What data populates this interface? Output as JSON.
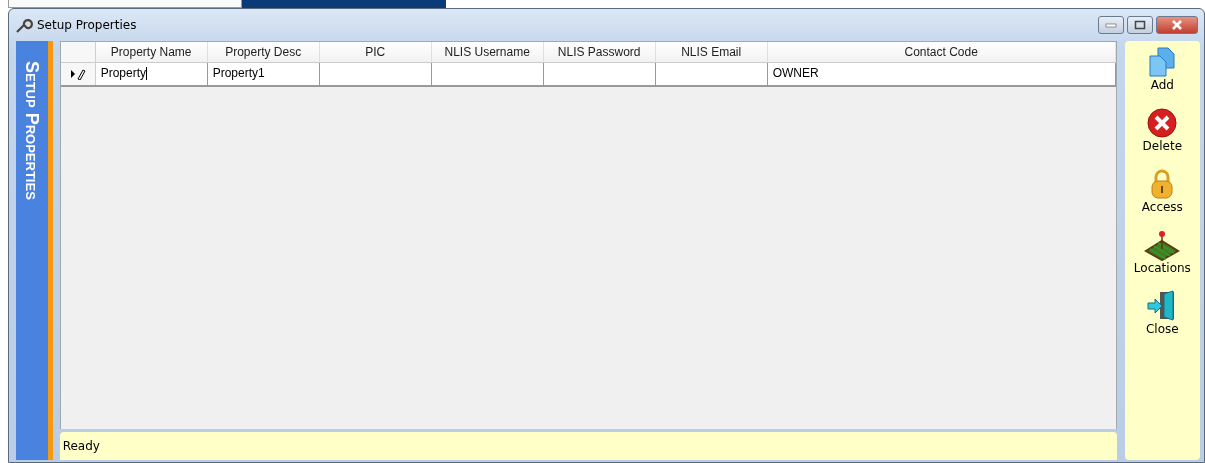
{
  "window": {
    "title": "Setup Properties"
  },
  "side_title": "Setup Properties",
  "table": {
    "columns": [
      "Property Name",
      "Property Desc",
      "PIC",
      "NLIS Username",
      "NLIS Password",
      "NLIS Email",
      "Contact Code"
    ],
    "rows": [
      {
        "editing": true,
        "cells": [
          "Property",
          "Property1",
          "",
          "",
          "",
          "",
          "OWNER"
        ]
      }
    ]
  },
  "toolbar": [
    {
      "kind": "add",
      "label": "Add"
    },
    {
      "kind": "delete",
      "label": "Delete"
    },
    {
      "kind": "access",
      "label": "Access"
    },
    {
      "kind": "locations",
      "label": "Locations"
    },
    {
      "kind": "close",
      "label": "Close"
    }
  ],
  "status_bar": "Ready"
}
